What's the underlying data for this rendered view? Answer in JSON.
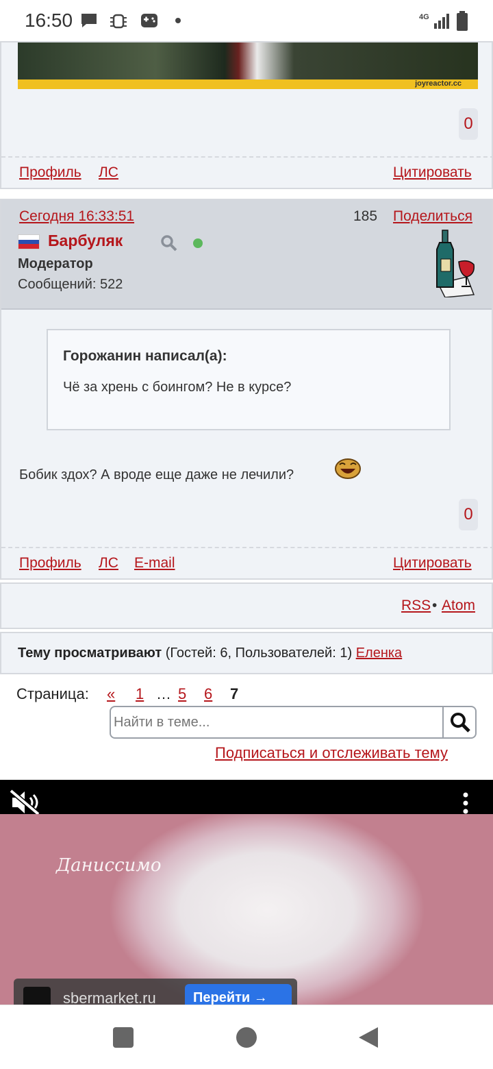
{
  "status_bar": {
    "time": "16:50",
    "network": "4G",
    "icons": [
      "chat-bubble-icon",
      "bug-icon",
      "gamepad-icon",
      "dot-icon",
      "signal-icon",
      "battery-icon"
    ]
  },
  "post1": {
    "watermark": "joyreactor.cc",
    "likes": "0",
    "footer": {
      "profile": "Профиль",
      "pm": "ЛС",
      "quote": "Цитировать"
    }
  },
  "post2": {
    "date": "Сегодня 16:33:51",
    "number": "185",
    "share": "Поделиться",
    "author": "Барбуляк",
    "role": "Модератор",
    "messages": "Сообщений: 522",
    "online_color": "#5cb85c",
    "quote": {
      "author": "Горожанин написал(а):",
      "text": "Чё за хрень с боингом? Не в курсе?"
    },
    "text": "Бобик здох? А вроде еще даже не лечили?",
    "likes": "0",
    "footer": {
      "profile": "Профиль",
      "pm": "ЛС",
      "email": "E-mail",
      "quote": "Цитировать"
    }
  },
  "feeds": {
    "rss": "RSS",
    "separator": "•",
    "atom": "Atom"
  },
  "viewers": {
    "label": "Тему просматривают",
    "counts": " (Гостей: 6, Пользователей: 1) ",
    "user": "Еленка"
  },
  "pagination": {
    "label": "Страница:",
    "prev": "«",
    "pages": [
      "1",
      "…",
      "5",
      "6",
      "7"
    ],
    "current": "7"
  },
  "search": {
    "placeholder": "Найти в теме..."
  },
  "subscribe": "Подписаться и отслеживать тему",
  "ad": {
    "brand": "Даниссимо",
    "domain": "sbermarket.ru",
    "cta": "Перейти →"
  },
  "colors": {
    "link": "#b5161b",
    "panel": "#f0f3f7",
    "header": "#d4d8de"
  }
}
